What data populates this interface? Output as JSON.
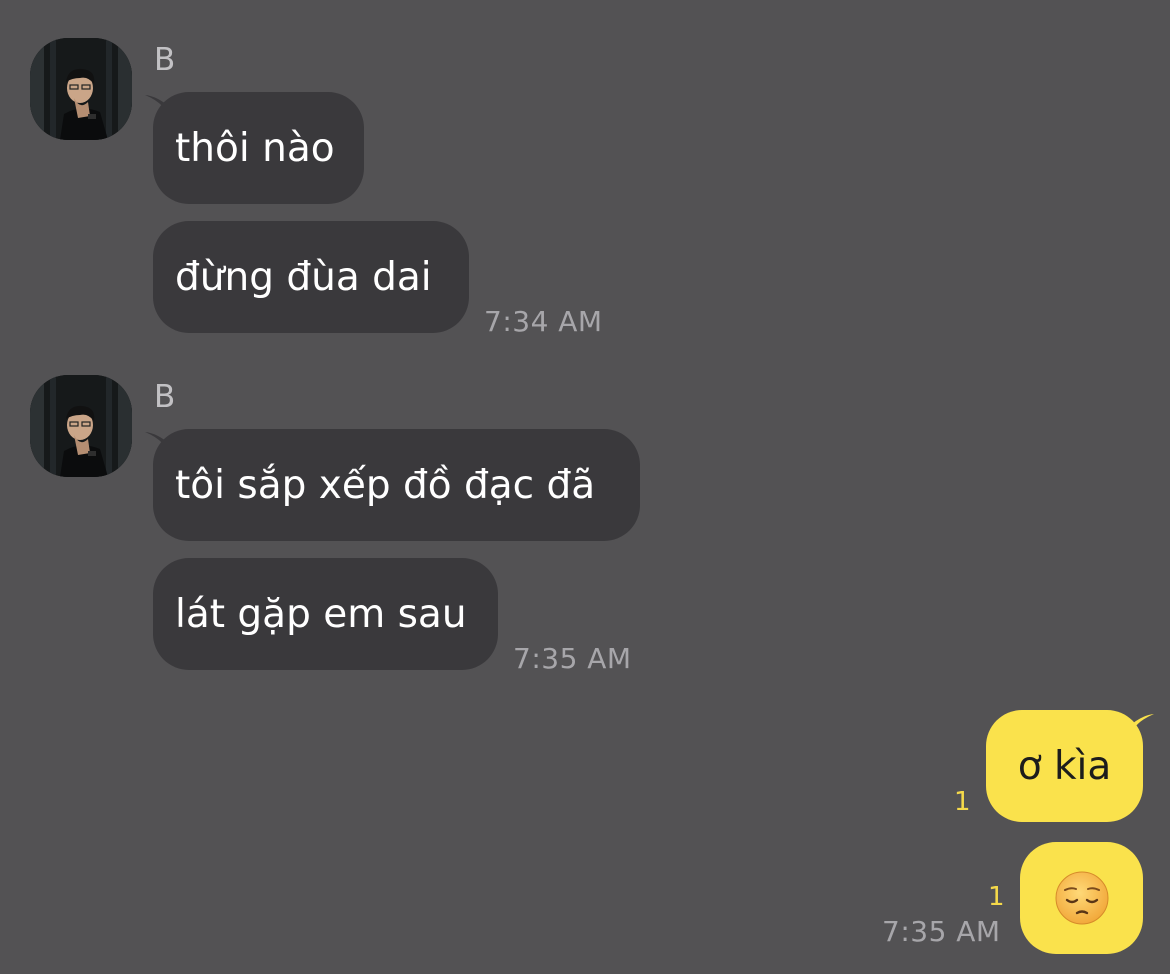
{
  "colors": {
    "background": "#535254",
    "incoming_bubble": "#3a393c",
    "outgoing_bubble": "#fae24c",
    "unread_count": "#f5d94a",
    "timestamp": "#a7a6aa"
  },
  "groups": [
    {
      "sender": "B",
      "avatar": "profile-photo",
      "messages": [
        "thôi nào",
        "đừng đùa dai"
      ],
      "time": "7:34 AM"
    },
    {
      "sender": "B",
      "avatar": "profile-photo",
      "messages": [
        "tôi sắp xếp đồ đạc đã",
        "lát gặp em sau"
      ],
      "time": "7:35 AM"
    }
  ],
  "outgoing": {
    "messages": [
      {
        "text": "ơ kìa",
        "unread": "1"
      },
      {
        "emoji": "pensive-face-emoji",
        "unread": "1"
      }
    ],
    "time": "7:35 AM"
  }
}
